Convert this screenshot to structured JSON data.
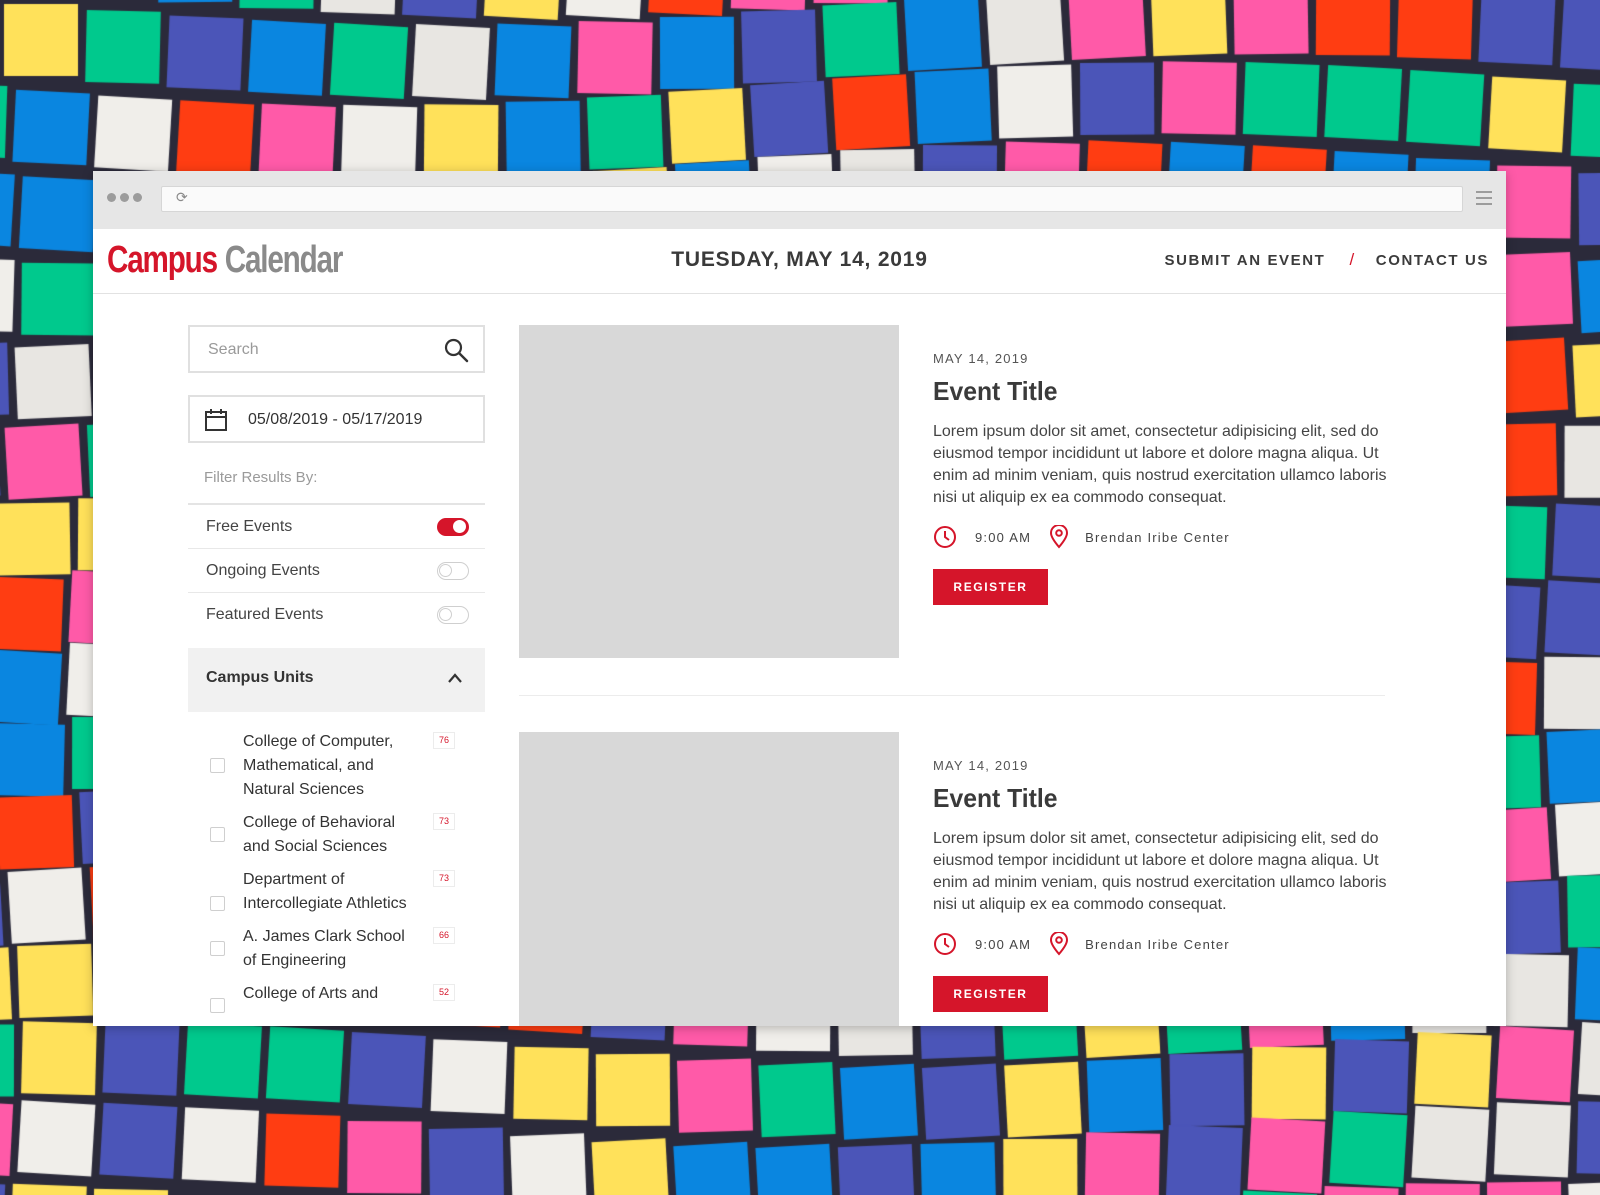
{
  "app": {
    "logo_primary": "Campus",
    "logo_secondary": "Calendar",
    "current_date": "TUESDAY, MAY 14, 2019",
    "nav": {
      "submit": "SUBMIT AN EVENT",
      "separator": "/",
      "contact": "CONTACT US"
    }
  },
  "colors": {
    "accent": "#d5152a",
    "placeholder": "#d8d8d8",
    "muted_text": "#9a9a9a"
  },
  "sidebar": {
    "search_placeholder": "Search",
    "date_range": "05/08/2019 - 05/17/2019",
    "filter_label": "Filter Results By:",
    "filters": [
      {
        "label": "Free Events",
        "on": true
      },
      {
        "label": "Ongoing Events",
        "on": false
      },
      {
        "label": "Featured Events",
        "on": false
      }
    ],
    "units_title": "Campus Units",
    "units": [
      {
        "name": "College of Computer, Mathematical, and Natural Sciences",
        "count": "76"
      },
      {
        "name": "College of Behavioral and Social Sciences",
        "count": "73"
      },
      {
        "name": "Department of Intercollegiate Athletics",
        "count": "73"
      },
      {
        "name": "A. James Clark School of Engineering",
        "count": "66"
      },
      {
        "name": "College of Arts and",
        "count": "52"
      }
    ]
  },
  "events": [
    {
      "date": "MAY 14, 2019",
      "title": "Event Title",
      "description": "Lorem ipsum dolor sit amet, consectetur adipisicing elit, sed do eiusmod tempor incididunt ut labore et dolore magna aliqua. Ut enim ad minim veniam, quis nostrud exercitation ullamco laboris nisi ut aliquip ex ea commodo consequat.",
      "time": "9:00 AM",
      "location": "Brendan Iribe Center",
      "cta": "REGISTER"
    },
    {
      "date": "MAY 14, 2019",
      "title": "Event Title",
      "description": "Lorem ipsum dolor sit amet, consectetur adipisicing elit, sed do eiusmod tempor incididunt ut labore et dolore magna aliqua. Ut enim ad minim veniam, quis nostrud exercitation ullamco laboris nisi ut aliquip ex ea commodo consequat.",
      "time": "9:00 AM",
      "location": "Brendan Iribe Center",
      "cta": "REGISTER"
    }
  ]
}
